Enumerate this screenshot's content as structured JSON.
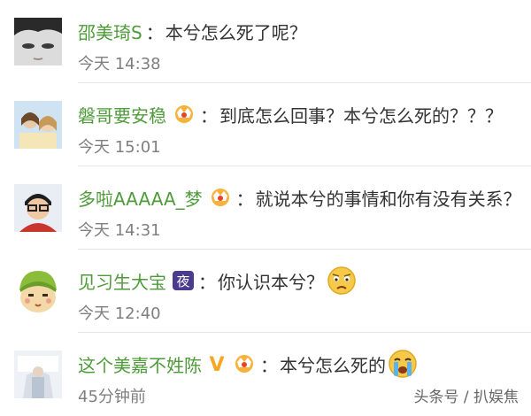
{
  "colors": {
    "username": "#4e9b3a",
    "text": "#333333",
    "time": "#7f7f7f",
    "divider": "#e6e6e6"
  },
  "comments": [
    {
      "username": "邵美琦S",
      "separator": "：",
      "text": "本兮怎么死了呢？",
      "time": "今天 14:38",
      "badges": []
    },
    {
      "username": "磐哥要安稳",
      "separator": "：",
      "text": "到底怎么回事？本兮怎么死的？？？",
      "time": "今天 15:01",
      "badges": [
        "vip-crown-icon"
      ]
    },
    {
      "username": "多啦AAAAA_梦",
      "separator": "：",
      "text": "就说本兮的事情和你有没有关系？",
      "time": "今天 14:31",
      "badges": [
        "vip-crown-icon"
      ]
    },
    {
      "username": "见习生大宝",
      "separator": "：",
      "text": "你认识本兮？",
      "time": "今天 12:40",
      "badges": [
        "night-badge-icon"
      ],
      "night_badge_label": "夜",
      "emoji": "sad-face-icon"
    },
    {
      "username": "这个美嘉不姓陈",
      "separator": "：",
      "text": "本兮怎么死的",
      "time": "45分钟前",
      "badges": [
        "verified-v-icon",
        "vip-crown-icon"
      ],
      "verified_label": "V",
      "emoji": "crying-face-icon"
    }
  ],
  "watermark": "头条号 / 扒娱焦"
}
